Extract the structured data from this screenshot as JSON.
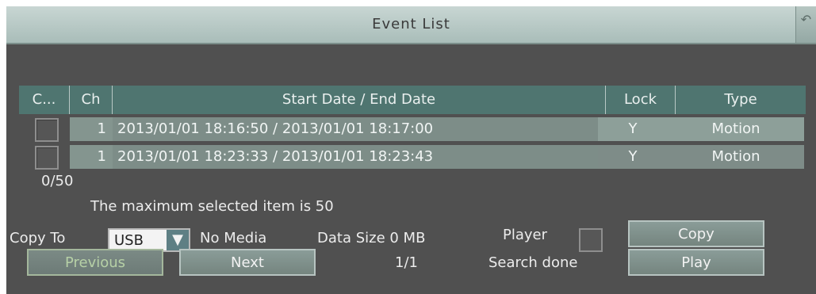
{
  "window": {
    "title": "Event List",
    "back_icon": "arrow-left-icon"
  },
  "table": {
    "headers": [
      "C...",
      "Ch",
      "Start Date / End Date",
      "Lock",
      "Type"
    ],
    "rows": [
      {
        "ch": "1",
        "dates": "2013/01/01 18:16:50 / 2013/01/01 18:17:00",
        "lock": "Y",
        "type": "Motion"
      },
      {
        "ch": "1",
        "dates": "2013/01/01 18:23:33 / 2013/01/01 18:23:43",
        "lock": "Y",
        "type": "Motion"
      }
    ]
  },
  "selection": {
    "count": "0/50",
    "max_message": "The maximum selected item is 50"
  },
  "copy": {
    "label": "Copy To",
    "device": "USB",
    "media_status": "No Media",
    "data_size": "Data Size 0 MB"
  },
  "player": {
    "label": "Player",
    "checked": false
  },
  "buttons": {
    "copy": "Copy",
    "play": "Play",
    "previous": "Previous",
    "next": "Next"
  },
  "pagination": {
    "page": "1/1"
  },
  "status": {
    "search": "Search done"
  },
  "colors": {
    "header_bg": "#4f7570",
    "row_bg": "#8d9f99",
    "title_bg": "#b6c8c4"
  }
}
